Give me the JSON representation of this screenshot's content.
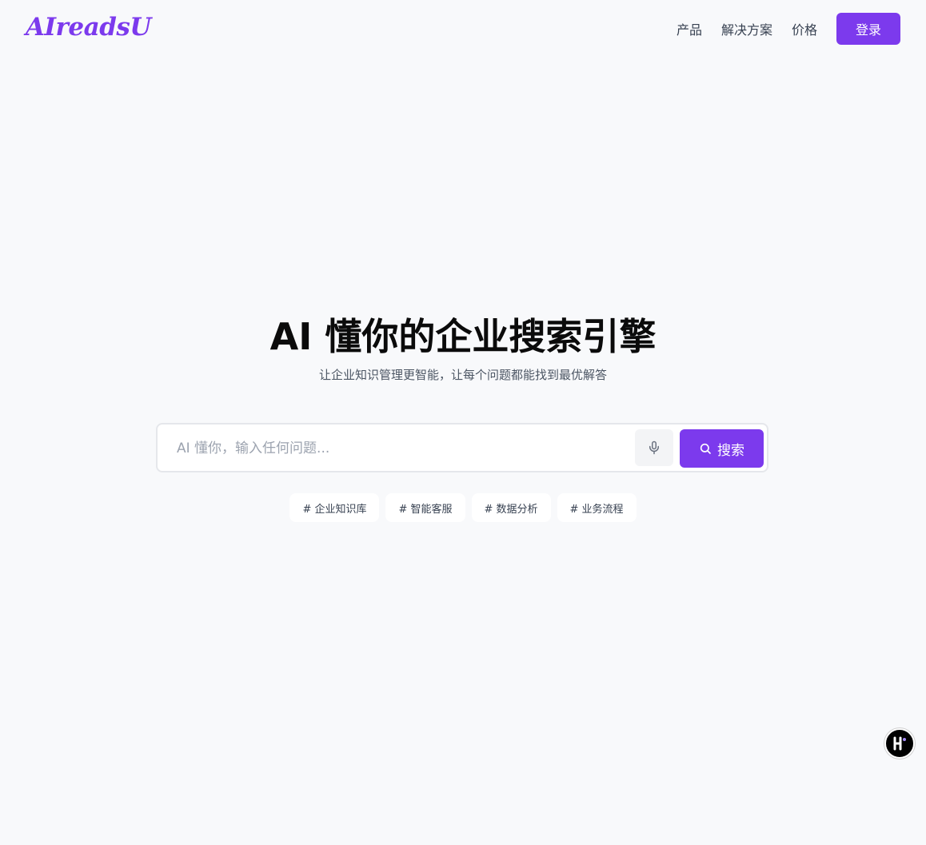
{
  "header": {
    "logo_text": "AIreadsU",
    "nav": [
      {
        "label": "产品"
      },
      {
        "label": "解决方案"
      },
      {
        "label": "价格"
      }
    ],
    "login_label": "登录"
  },
  "hero": {
    "title": "AI 懂你的企业搜索引擎",
    "subtitle": "让企业知识管理更智能，让每个问题都能找到最优解答"
  },
  "search": {
    "placeholder": "AI 懂你，输入任何问题...",
    "value": "",
    "mic_icon": "microphone-icon",
    "button_icon": "search-icon",
    "button_label": "搜索"
  },
  "tags": [
    {
      "label": "# 企业知识库"
    },
    {
      "label": "# 智能客服"
    },
    {
      "label": "# 数据分析"
    },
    {
      "label": "# 业务流程"
    }
  ],
  "floating_badge": {
    "icon": "k-logo-icon"
  },
  "colors": {
    "accent": "#7c3aed",
    "background": "#f8f9fb",
    "title": "#0b0b0b",
    "muted_text": "#4b5563"
  }
}
